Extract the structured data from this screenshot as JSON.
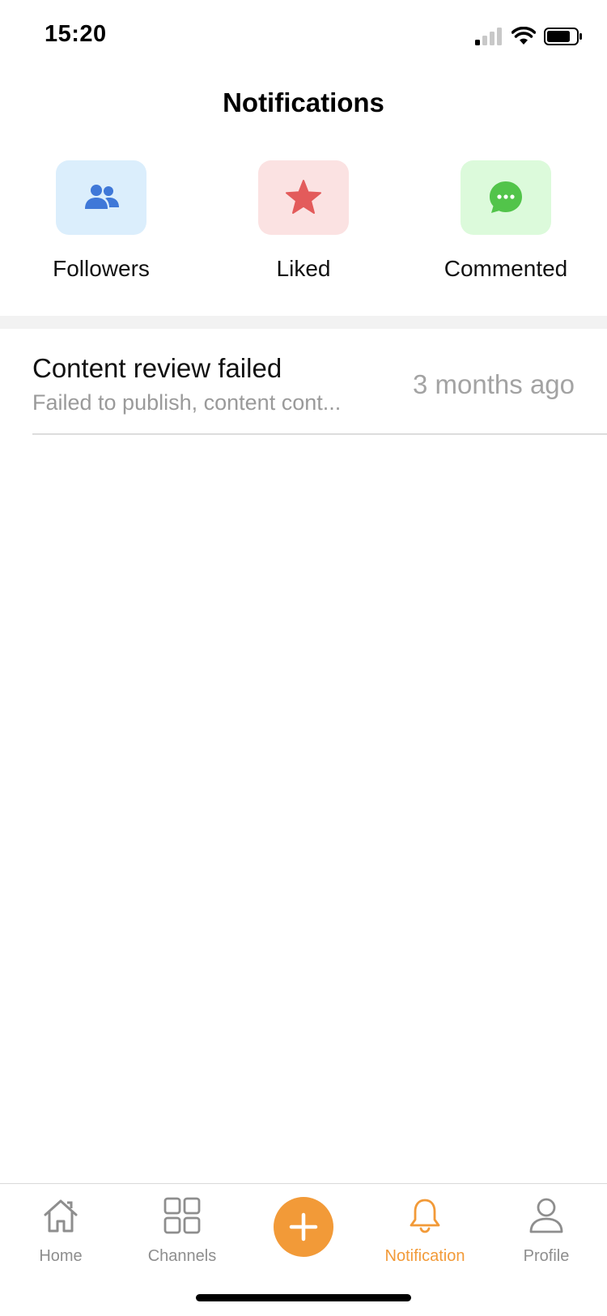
{
  "status": {
    "time": "15:20"
  },
  "header": {
    "title": "Notifications"
  },
  "categories": [
    {
      "label": "Followers",
      "icon": "followers-icon",
      "bg": "#dbeefc",
      "color": "#3f78d8"
    },
    {
      "label": "Liked",
      "icon": "star-icon",
      "bg": "#fbe2e2",
      "color": "#e35b5b"
    },
    {
      "label": "Commented",
      "icon": "comment-icon",
      "bg": "#dcfadb",
      "color": "#52c44a"
    }
  ],
  "notifications": [
    {
      "title": "Content review failed",
      "subtitle": "Failed to publish, content cont...",
      "time": "3 months ago"
    }
  ],
  "tabbar": {
    "accent": "#f29a38",
    "items": [
      {
        "label": "Home",
        "icon": "home-icon",
        "active": false
      },
      {
        "label": "Channels",
        "icon": "grid-icon",
        "active": false
      },
      {
        "label": "",
        "icon": "plus-icon",
        "active": false
      },
      {
        "label": "Notification",
        "icon": "bell-icon",
        "active": true
      },
      {
        "label": "Profile",
        "icon": "person-icon",
        "active": false
      }
    ]
  }
}
